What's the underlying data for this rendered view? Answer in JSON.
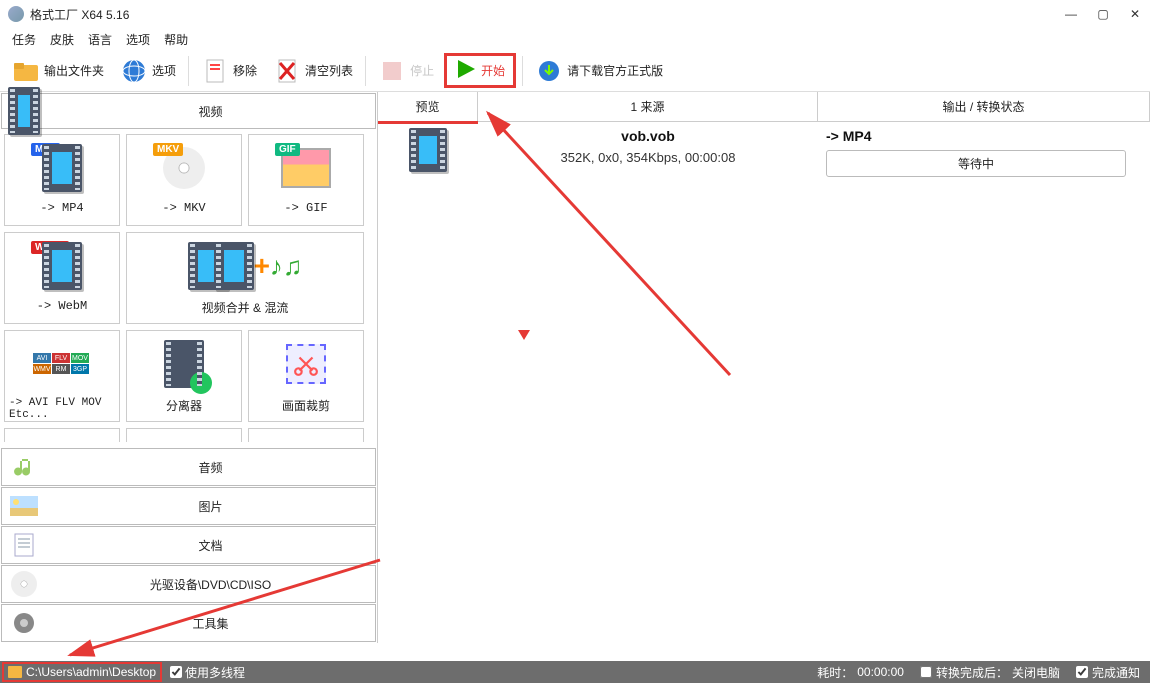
{
  "window": {
    "title": "格式工厂 X64 5.16"
  },
  "menu": {
    "items": [
      "任务",
      "皮肤",
      "语言",
      "选项",
      "帮助"
    ]
  },
  "toolbar": {
    "output_folder": "输出文件夹",
    "options": "选项",
    "remove": "移除",
    "clear_list": "清空列表",
    "stop": "停止",
    "start": "开始",
    "download_link": "请下载官方正式版"
  },
  "left": {
    "video_header": "视频",
    "tiles": {
      "mp4": "-> MP4",
      "mkv": "-> MKV",
      "gif": "-> GIF",
      "webm": "-> WebM",
      "merge": "视频合并 & 混流",
      "avi": "-> AVI FLV MOV Etc...",
      "splitter": "分离器",
      "crop": "画面裁剪"
    },
    "cats": {
      "audio": "音频",
      "image": "图片",
      "doc": "文档",
      "disc": "光驱设备\\DVD\\CD\\ISO",
      "tools": "工具集"
    }
  },
  "table": {
    "head": {
      "preview": "预览",
      "source": "1 来源",
      "output": "输出 / 转换状态"
    },
    "row": {
      "fname": "vob.vob",
      "finfo": "352K, 0x0, 354Kbps, 00:00:08",
      "outfmt": "-> MP4",
      "status": "等待中"
    }
  },
  "status": {
    "path": "C:\\Users\\admin\\Desktop",
    "multithread": "使用多线程",
    "elapsed_label": "耗时：",
    "elapsed_value": "00:00:00",
    "after_label": "转换完成后：",
    "after_value": "关闭电脑",
    "notify": "完成通知"
  }
}
